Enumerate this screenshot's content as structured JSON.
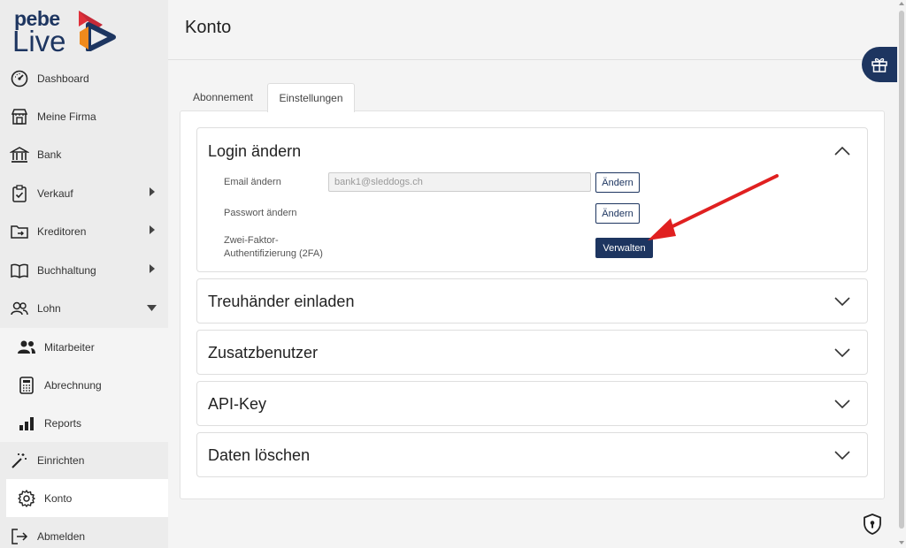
{
  "brand": {
    "name_top": "pebe",
    "name_bottom": "Live"
  },
  "sidebar": {
    "items": [
      {
        "label": "Dashboard",
        "icon": "gauge-icon"
      },
      {
        "label": "Meine Firma",
        "icon": "store-icon"
      },
      {
        "label": "Bank",
        "icon": "bank-icon"
      },
      {
        "label": "Verkauf",
        "icon": "clipboard-check-icon"
      },
      {
        "label": "Kreditoren",
        "icon": "folder-arrow-icon"
      },
      {
        "label": "Buchhaltung",
        "icon": "book-icon"
      },
      {
        "label": "Lohn",
        "icon": "users-icon"
      },
      {
        "label": "Mitarbeiter",
        "icon": "people-icon"
      },
      {
        "label": "Abrechnung",
        "icon": "calculator-icon"
      },
      {
        "label": "Reports",
        "icon": "bar-chart-icon"
      },
      {
        "label": "Einrichten",
        "icon": "magic-wand-icon"
      },
      {
        "label": "Konto",
        "icon": "gear-icon"
      },
      {
        "label": "Abmelden",
        "icon": "logout-icon"
      }
    ]
  },
  "header": {
    "title": "Konto"
  },
  "tabs": [
    {
      "label": "Abonnement"
    },
    {
      "label": "Einstellungen"
    }
  ],
  "login": {
    "title": "Login ändern",
    "email_label": "Email ändern",
    "email_value": "bank1@sleddogs.ch",
    "password_label": "Passwort ändern",
    "twofa_label_1": "Zwei-Faktor-",
    "twofa_label_2": "Authentifizierung (2FA)",
    "change_button": "Ändern",
    "change_button_2": "Ändern",
    "manage_button": "Verwalten"
  },
  "sections": [
    {
      "title": "Treuhänder einladen"
    },
    {
      "title": "Zusatzbenutzer"
    },
    {
      "title": "API-Key"
    },
    {
      "title": "Daten löschen"
    }
  ],
  "colors": {
    "brand": "#1d3560",
    "annotation_arrow": "#e02020",
    "logo_red": "#e0303a",
    "logo_orange": "#f08a1c"
  }
}
